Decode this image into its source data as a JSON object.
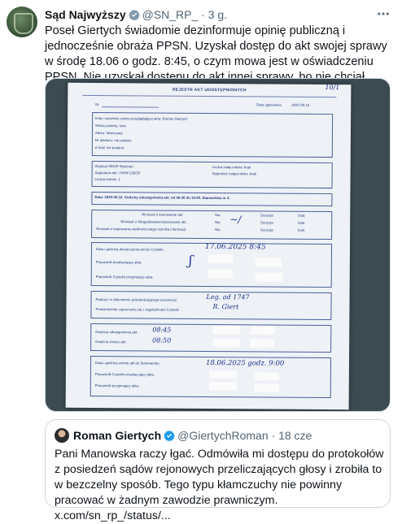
{
  "author": {
    "display_name": "Sąd Najwyższy",
    "handle": "@SN_RP_",
    "separator": "·",
    "time": "3 g."
  },
  "tweet": {
    "text": "Poseł Giertych świadomie dezinformuje opinię publiczną i jednocześnie obraża PPSN. Uzyskał dostęp do akt swojej sprawy w środę 18.06 o godz. 8:45, o czym mowa jest w oświadczeniu PPSN. Nie uzyskał dostępu do akt innej sprawy, bo nie chciał złożyć stosownego wniosku."
  },
  "document": {
    "title": "REJESTR AKT UDOSTĘPNIONYCH",
    "corner_note": "10/1",
    "nr_label": "Nr",
    "date_label": "Data zgłoszenia",
    "date_value": "2025-06-18",
    "requester": {
      "l1": "Imię i nazwisko osoby przeglądającej akta: Roman Giertych",
      "l2": "Status prawny: inne",
      "l3": "Adres: Warszawa",
      "l4": "Nr telefonu: nie podano",
      "l5": "e-mail: nie podano"
    },
    "case": {
      "l1": "Wydział: BNSP Wydział I",
      "l2": "Sygnatura akt: I NSW 238/25",
      "l3": "Liczba tomów: 1",
      "r1": "Liczba załączników: brak",
      "r2": "Sygnatury załączników: brak"
    },
    "slot": "Data: 2025-06-18. Godziny udostępnienia akt: od 09:30 do 10:00. Stanowisko nr 4.",
    "requests": {
      "l1": "Wniosek o kserowanie akt:",
      "l2": "Wniosek o fotografowanie/skanowanie akt:",
      "l3": "Wniosek o kopiowanie elektronicznego nośnika informacji:",
      "v1": "Nie",
      "v2": "Nie",
      "v3": "Nie",
      "d1": "Decyzja:",
      "d2": "Decyzja:",
      "d3": "Decyzja:",
      "r1": "brak",
      "r2": "brak",
      "r3": "brak"
    },
    "delivery": {
      "l1": "Data i godzina dostarczenia akt do Czytelni:",
      "l2": "Pracownik przekazujący akta:",
      "l3": "Pracownik Czytelni przyjmujący akta:",
      "h1": "17.06.2025 8:45"
    },
    "confirm": {
      "l1": "Rodzaj i nr dokumentu potwierdzającego tożsamość:",
      "l2": "Potwierdzenie zapoznania się z regulaminem Czytelni",
      "h1": "Leg. ad 1747",
      "h2": "R. Giert"
    },
    "access": {
      "l1": "Godzina udostępnienia akt:",
      "l2": "Godzina zwrotu akt:",
      "h1": "08:45",
      "h2": "08:50"
    },
    "return": {
      "l1": "Data i godzina zwrotu akt do Sekretariatu:",
      "l2": "Pracownik Czytelni przekazujący akta:",
      "l3": "Pracownik przyjmujący akta:",
      "h1": "18.06.2025 godz. 9:00"
    }
  },
  "quote": {
    "display_name": "Roman Giertych",
    "handle": "@GiertychRoman",
    "separator": "·",
    "time": "18 cze",
    "text": "Pani Manowska raczy łgać. Odmówiła mi dostępu do protokołów z posiedzeń sądów rejonowych przeliczających głosy i zrobiła to w bezczelny sposób. Tego typu kłamczuchy nie powinny pracować w żadnym zawodzie prawniczym. x.com/sn_rp_/status/..."
  },
  "colors": {
    "text": "#0f1419",
    "secondary": "#536471",
    "border": "#cfd9de",
    "verified_gray": "#829aab",
    "verified_blue": "#1d9bf0"
  },
  "icons": {
    "author_badge": "gray-verified-badge-icon",
    "quote_badge": "blue-verified-badge-icon",
    "more": "more-options-icon"
  }
}
